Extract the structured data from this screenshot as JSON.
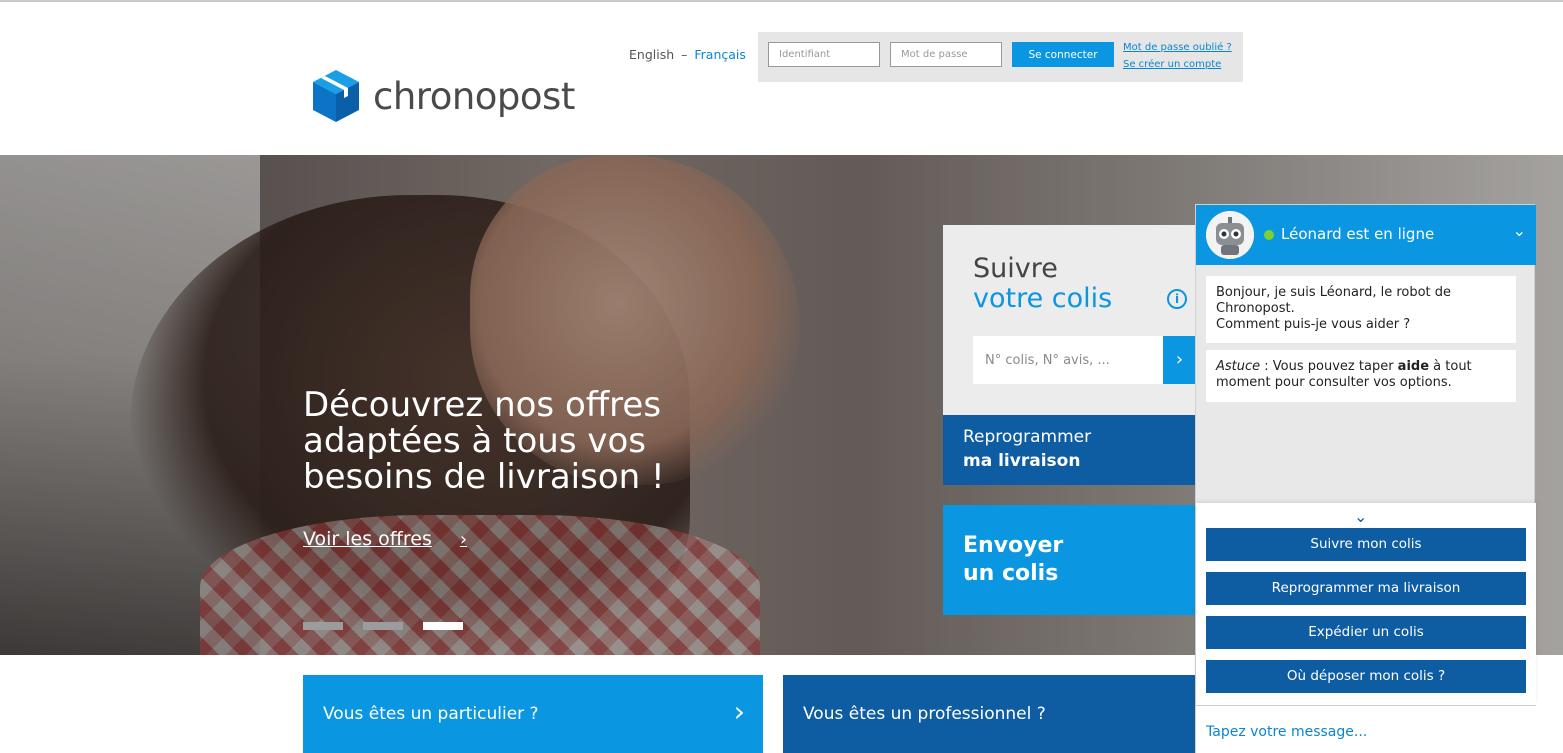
{
  "header": {
    "brand": "chronopost",
    "lang_english": "English",
    "lang_sep": "–",
    "lang_french": "Français",
    "login": {
      "id_placeholder": "Identifiant",
      "password_placeholder": "Mot de passe",
      "connect_label": "Se connecter",
      "forgot_label": "Mot de passe oublié ?",
      "create_label": "Se créer un compte"
    }
  },
  "hero": {
    "title": "Découvrez nos offres adaptées à tous vos besoins de livraison !",
    "link_label": "Voir les offres",
    "link_chevron": "›",
    "slides_count": 3,
    "active_slide": 3
  },
  "track": {
    "title_line1": "Suivre",
    "title_line2": "votre colis",
    "info_glyph": "i",
    "input_placeholder": "N° colis, N° avis, ...",
    "go_glyph": "›"
  },
  "reprogram": {
    "line1": "Reprogrammer",
    "line2": "ma livraison"
  },
  "send": {
    "line1": "Envoyer",
    "line2": "un colis"
  },
  "tiles": {
    "particulier": "Vous êtes un particulier ?",
    "professionnel": "Vous êtes un professionnel ?",
    "chevron": "›"
  },
  "chat": {
    "title": "Léonard est en ligne",
    "collapse_glyph": "⌄",
    "message1_line1": "Bonjour, je suis Léonard, le robot de Chronopost.",
    "message1_line2": "Comment puis-je vous aider ?",
    "message2_em": "Astuce",
    "message2_pre": " : Vous pouvez taper ",
    "message2_bold": "aide",
    "message2_post": " à tout moment pour consulter vos options.",
    "menu_toggle_glyph": "⌄",
    "buttons": [
      "Suivre mon colis",
      "Reprogrammer ma livraison",
      "Expédier un colis",
      "Où déposer mon colis ?"
    ],
    "input_placeholder": "Tapez votre message..."
  },
  "colors": {
    "brand_blue": "#0a96e0",
    "dark_blue": "#0e5da3",
    "online_green": "#7bd12f"
  }
}
